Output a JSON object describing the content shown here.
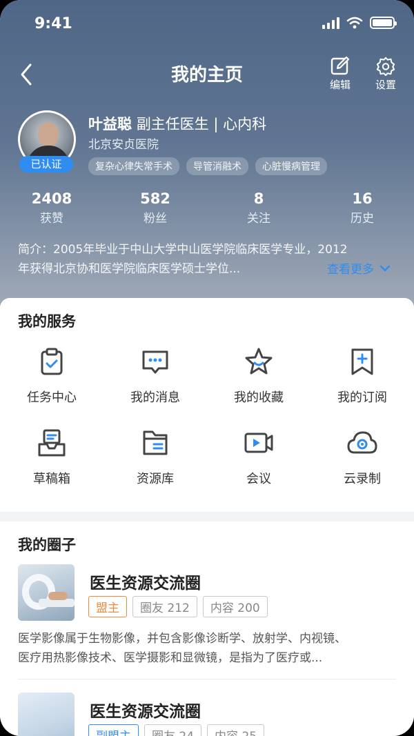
{
  "status": {
    "time": "9:41"
  },
  "nav": {
    "title": "我的主页",
    "edit_label": "编辑",
    "settings_label": "设置"
  },
  "profile": {
    "name": "叶益聪",
    "title_dept": "副主任医生 | 心内科",
    "hospital": "北京安贞医院",
    "verified": "已认证",
    "tags": [
      "复杂心律失常手术",
      "导管消融术",
      "心脏慢病管理"
    ]
  },
  "stats": [
    {
      "value": "2408",
      "label": "获赞"
    },
    {
      "value": "582",
      "label": "粉丝"
    },
    {
      "value": "8",
      "label": "关注"
    },
    {
      "value": "16",
      "label": "历史"
    }
  ],
  "intro": {
    "line1": "简介：2005年毕业于中山大学中山医学院临床医学专业，2012",
    "line2": "年获得北京协和医学院临床医学硕士学位...",
    "more": "查看更多"
  },
  "services": {
    "title": "我的服务",
    "items": [
      {
        "label": "任务中心",
        "icon": "clipboard-check-icon"
      },
      {
        "label": "我的消息",
        "icon": "message-icon"
      },
      {
        "label": "我的收藏",
        "icon": "star-icon"
      },
      {
        "label": "我的订阅",
        "icon": "bookmark-plus-icon"
      },
      {
        "label": "草稿箱",
        "icon": "inbox-icon"
      },
      {
        "label": "资源库",
        "icon": "folder-icon"
      },
      {
        "label": "会议",
        "icon": "video-icon"
      },
      {
        "label": "云录制",
        "icon": "cloud-record-icon"
      }
    ]
  },
  "circles": {
    "title": "我的圈子",
    "items": [
      {
        "name": "医生资源交流圈",
        "role": "盟主",
        "members": "圈友 212",
        "posts": "内容 200",
        "desc_line1": "医学影像属于生物影像，并包含影像诊断学、放射学、内视镜、",
        "desc_line2": "医疗用热影像技术、医学摄影和显微镜，是指为了医疗或..."
      },
      {
        "name": "医生资源交流圈",
        "role": "副盟主",
        "members": "圈友 24",
        "posts": "内容 25"
      }
    ]
  },
  "colors": {
    "accent": "#2f8cf0",
    "owner": "#f08a3c"
  }
}
